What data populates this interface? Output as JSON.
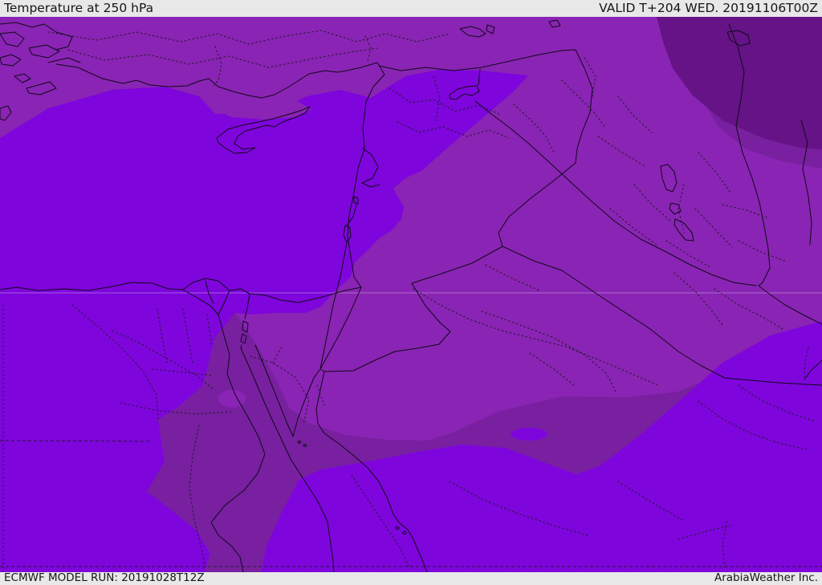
{
  "header": {
    "title": "Temperature at 250 hPa",
    "valid_label": "VALID T+204 WED. 20191106T00Z"
  },
  "footer": {
    "model_run_label": "ECMWF MODEL RUN: 20191028T12Z",
    "credit_label": "ArabiaWeather Inc."
  },
  "map": {
    "kind": "temperature shading map, Middle East / East Mediterranean",
    "colors": {
      "bright": "#7E05DC",
      "medium": "#8A24B4",
      "dark": "#7820A0",
      "darkest": "#651386",
      "line": "#0E0A18",
      "dotted": "#241B30",
      "grid": "#D9C4F2",
      "panel": "#E8E8E8",
      "panel_text": "#151515"
    }
  }
}
